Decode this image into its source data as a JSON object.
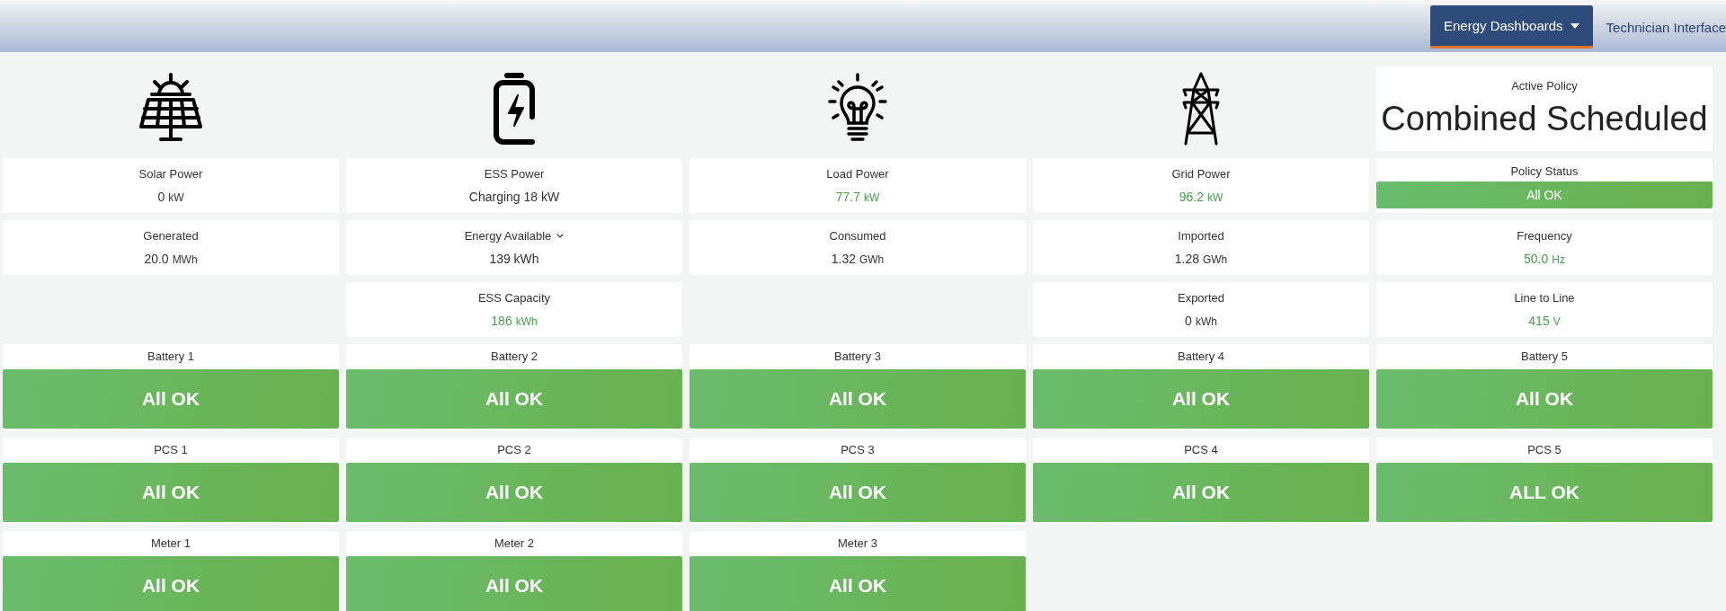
{
  "nav": [
    {
      "label": "Energy Dashboards",
      "dropdown": true,
      "selected": true
    },
    {
      "label": "Technician Interface",
      "dropdown": false,
      "selected": false
    }
  ],
  "columns": [
    {
      "metrics": [
        {
          "label": "Solar Power",
          "value": "0",
          "unit": "kW",
          "green": false
        },
        {
          "label": "Generated",
          "value": "20.0",
          "unit": "MWh",
          "green": false
        }
      ],
      "statuses": [
        {
          "title": "Battery 1",
          "text": "All OK"
        },
        {
          "title": "PCS 1",
          "text": "All OK"
        },
        {
          "title": "Meter 1",
          "text": "All OK"
        }
      ]
    },
    {
      "metrics": [
        {
          "label": "ESS Power",
          "value": "Charging 18 kW",
          "green": false
        },
        {
          "label": "Energy Available",
          "menu": true,
          "value": "139 kWh",
          "green": false
        },
        {
          "label": "ESS Capacity",
          "value": "186",
          "unit": "kWh",
          "green": true
        }
      ],
      "statuses": [
        {
          "title": "Battery 2",
          "text": "All OK"
        },
        {
          "title": "PCS 2",
          "text": "All OK"
        },
        {
          "title": "Meter 2",
          "text": "All OK"
        }
      ]
    },
    {
      "metrics": [
        {
          "label": "Load Power",
          "value": "77.7",
          "unit": "kW",
          "green": true
        },
        {
          "label": "Consumed",
          "value": "1.32",
          "unit": "GWh",
          "green": false
        }
      ],
      "statuses": [
        {
          "title": "Battery 3",
          "text": "All OK"
        },
        {
          "title": "PCS 3",
          "text": "All OK"
        },
        {
          "title": "Meter 3",
          "text": "All OK"
        }
      ]
    },
    {
      "metrics": [
        {
          "label": "Grid Power",
          "value": "96.2",
          "unit": "kW",
          "green": true
        },
        {
          "label": "Imported",
          "value": "1.28",
          "unit": "GWh",
          "green": false
        },
        {
          "label": "Exported",
          "value": "0",
          "unit": "kWh",
          "green": false
        }
      ],
      "statuses": [
        {
          "title": "Battery 4",
          "text": "All OK"
        },
        {
          "title": "PCS 4",
          "text": "All OK"
        }
      ]
    },
    {
      "policy": {
        "title": "Active Policy",
        "value": "Combined Scheduled"
      },
      "metrics": [
        {
          "label": "Policy Status",
          "status": "All OK"
        },
        {
          "label": "Frequency",
          "value": "50.0",
          "unit": "Hz",
          "green": true
        },
        {
          "label": "Line to Line",
          "value": "415",
          "unit": "V",
          "green": true
        }
      ],
      "statuses": [
        {
          "title": "Battery 5",
          "text": "All OK"
        },
        {
          "title": "PCS 5",
          "text": "ALL OK"
        }
      ]
    }
  ]
}
